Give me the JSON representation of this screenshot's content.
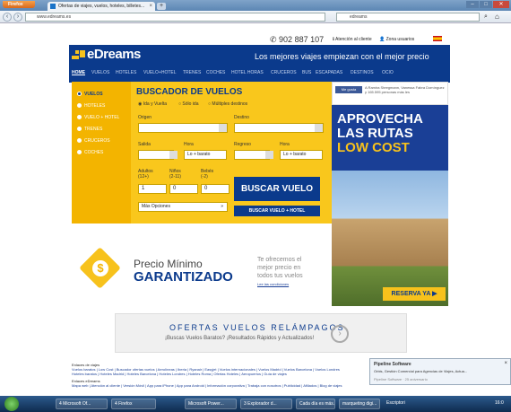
{
  "browser": {
    "app_button": "Firefox",
    "tab_title": "Ofertas de viajes, vuelos, hoteles, billetes...",
    "url": "www.edreams.es",
    "search_value": "edreams",
    "new_tab_label": "+"
  },
  "topbar": {
    "phone": "902 887 107",
    "help": "Atención al cliente",
    "user_zone": "Zona usuarios"
  },
  "header": {
    "logo": "eDreams",
    "slogan": "Los mejores viajes empiezan con el mejor precio",
    "menu": [
      "HOME",
      "VUELOS",
      "HOTELES",
      "VUELO+HOTEL",
      "TRENES",
      "COCHES",
      "HOTEL HORAS",
      "CRUCEROS",
      "BUS",
      "ESCAPADAS",
      "DESTINOS",
      "OCIO"
    ]
  },
  "side_menu": [
    "VUELOS",
    "HOTELES",
    "VUELO + HOTEL",
    "TRENES",
    "CRUCEROS",
    "COCHES"
  ],
  "search": {
    "title": "BUSCADOR DE VUELOS",
    "trip_types": [
      "Ida y Vuelta",
      "Sólo ida",
      "Múltiples destinos"
    ],
    "origin_label": "Origen",
    "dest_label": "Destino",
    "depart_label": "Salida",
    "return_label": "Regreso",
    "time_label": "Hora",
    "time_value": "Lo + barato",
    "adults_label": "Adultos",
    "adults_sub": "(12+)",
    "children_label": "Niños",
    "children_sub": "(2-11)",
    "babies_label": "Bebés",
    "babies_sub": "(-2)",
    "adults_value": "1",
    "children_value": "0",
    "babies_value": "0",
    "more_options": "Más Opciones",
    "search_button": "BUSCAR VUELO",
    "search_hotel_button": "BUSCAR VUELO + HOTEL"
  },
  "price_banner": {
    "title_1": "Precio Mínimo",
    "title_2": "GARANTIZADO",
    "text_1": "Te ofrecemos el",
    "text_2": "mejor precio en",
    "text_3": "todos tus vuelos",
    "link": "Lee las condiciones"
  },
  "side_ad": {
    "fb_label": "Me gusta",
    "fb_text": "A Ramira Steegmann, Vanessa Fabra Domínguez y 165.595 personas más les",
    "line1": "APROVECHA",
    "line2": "LAS RUTAS",
    "line3": "LOW COST",
    "cta": "RESERVA YA ▶"
  },
  "ofertas_ad": {
    "title": "OFERTAS VUELOS RELÁMPAGOS",
    "subtitle": "¡Buscas Vuelos Baratos? ¡Resultados Rápidos y Actualizados!"
  },
  "footer": {
    "heading1": "Enlaces de viajes",
    "links1": "Vuelos baratos | Low Cost | Buscador ofertas vuelos | Aerolíneas | Iberia | Ryanair | Easyjet | Vuelos internacionales | Vuelos Madrid | Vuelos Barcelona | Vuelos Londres",
    "links2": "Hoteles baratos | Hoteles Madrid | Hoteles Barcelona | Hoteles Londres | Hoteles Roma | Ofertas Hoteles | Aeropuertos | Guía de viajes",
    "heading2": "Enlaces eDreams",
    "links3": "Mapa web | Atención al cliente | Versión Móvil | App para iPhone | App para Android | Información corporativa | Trabaja con nosotros | Publicidad | Afiliados | Blog de viajes"
  },
  "notification": {
    "title": "Pipeline Software",
    "text": "Orbis, Gestión Comercial para Agencias de Viajes, Actua...",
    "sub": "Pipeline Software · 25 aniversario"
  },
  "taskbar": {
    "items": [
      "4 Microsoft Of...",
      "4 Firefox",
      "Microsoft Power...",
      "3 Explorador d...",
      "Cada día es más...",
      "marqueting digi...",
      "Escriptori"
    ],
    "clock": "16:0"
  }
}
